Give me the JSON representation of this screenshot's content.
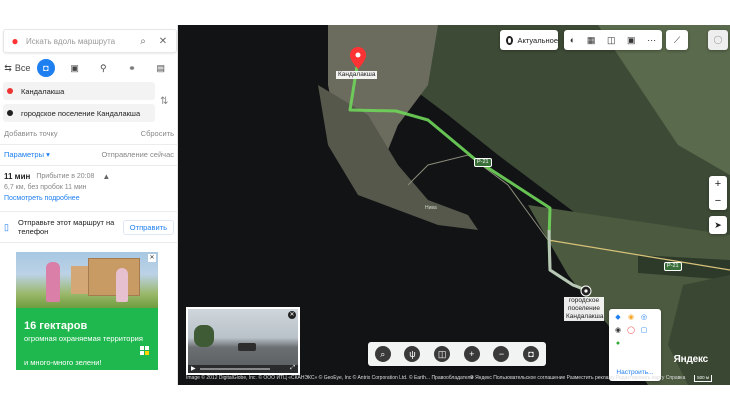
{
  "search": {
    "placeholder": "Искать вдоль маршрута"
  },
  "modes": {
    "all_label": "Все"
  },
  "points": {
    "from": "Кандалакша",
    "to": "городское поселение Кандалакша"
  },
  "links": {
    "add_point": "Добавить точку",
    "reset": "Сбросить"
  },
  "params": {
    "label": "Параметры ▾",
    "departure": "Отправление сейчас"
  },
  "route": {
    "duration": "11 мин",
    "arrival": "Прибытие в 20:08",
    "details": "6,7 км, без пробок 11 мин",
    "more": "Посмотреть подробнее"
  },
  "send": {
    "text": "Отправьте этот маршрут на телефон",
    "button": "Отправить"
  },
  "ad": {
    "headline": "16 гектаров",
    "body": "огромная охраняемая территория",
    "tail": "и много-много зелени!"
  },
  "map": {
    "actual_label": "Актуальное",
    "city_label": "Кандалакша",
    "dest_label": "городское поселение Кандалакша",
    "road_shield_1": "Р-21",
    "road_shield_2": "Р-21",
    "river_label": "Нива",
    "brand": "Яндекс",
    "copyright": "Image © 2012 DigitalGlobe, Inc. © ООО ИТЦ «СКАНЭКС» © GeoEye, Inc © Antrix Corporation Ltd. © Earth...  Правообладатели",
    "footer_links": "© Яндекс   Пользовательское соглашение   Разместить рекламу   Редактировать карту   Справка",
    "scale": "500 м",
    "services_config": "Настроить..."
  },
  "colors": {
    "route": "#6fd65a",
    "accent": "#1e7ff0",
    "pin": "#f33",
    "ad_green": "#1fb84e"
  }
}
